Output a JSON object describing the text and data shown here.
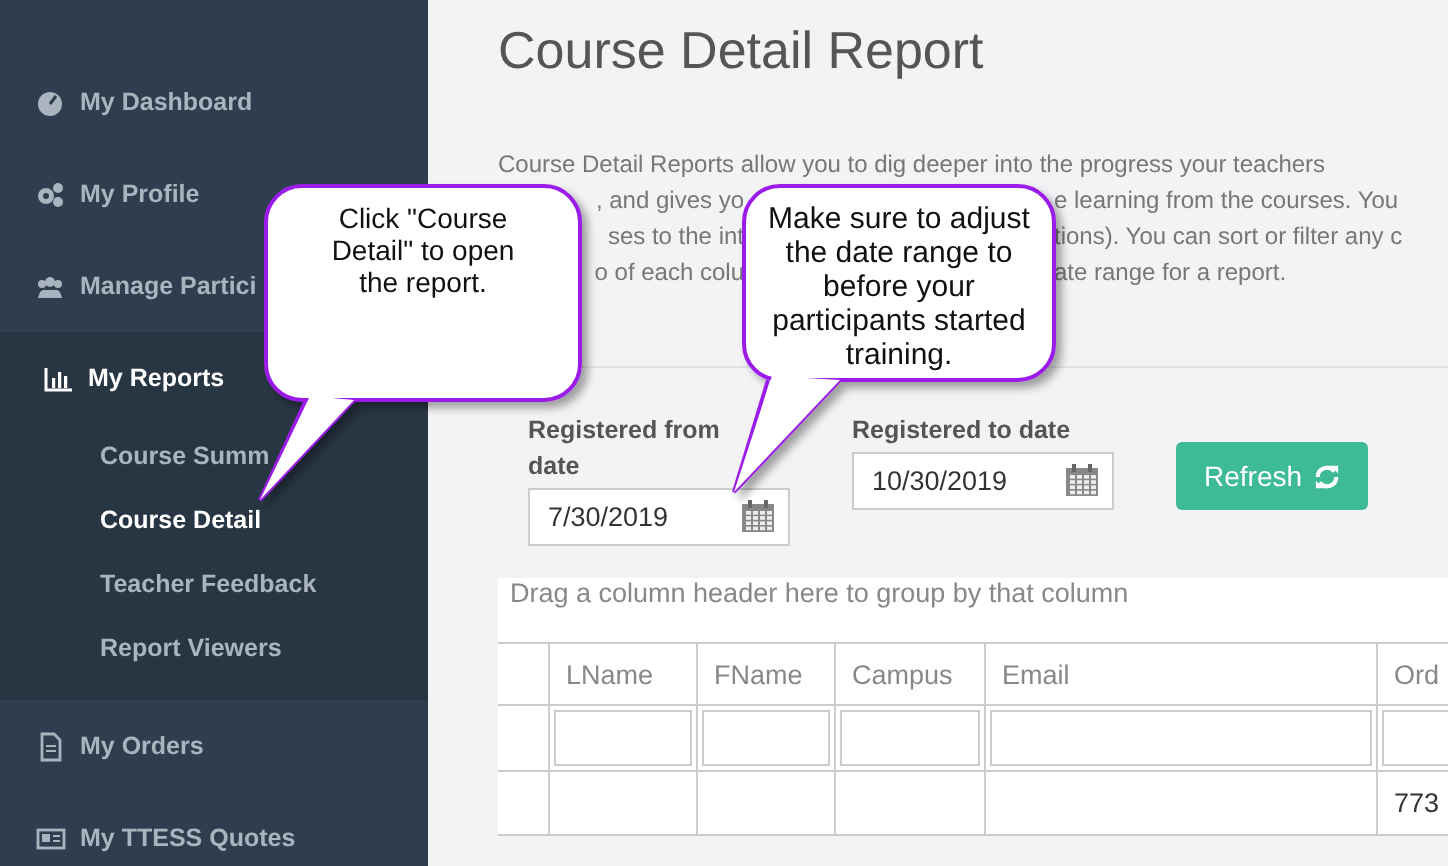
{
  "sidebar": {
    "items": [
      {
        "label": "My Dashboard",
        "selected": false
      },
      {
        "label": "My Profile",
        "selected": false
      },
      {
        "label": "Manage Partici",
        "selected": false
      },
      {
        "label": "My Reports",
        "selected": true,
        "children": [
          {
            "label": "Course Summ",
            "selected": false
          },
          {
            "label": "Course Detail",
            "selected": true
          },
          {
            "label": "Teacher Feedback",
            "selected": false
          },
          {
            "label": "Report Viewers",
            "selected": false
          }
        ]
      },
      {
        "label": "My Orders",
        "selected": false
      },
      {
        "label": "My TTESS Quotes",
        "selected": false
      }
    ]
  },
  "page_title": "Course Detail Report",
  "intro_lines": [
    {
      "segments": [
        "Course Detail Reports allow you to dig deeper into the progress your teachers"
      ]
    },
    {
      "segments": [
        ", and gives yo",
        "e learning from the courses. You"
      ]
    },
    {
      "segments": [
        "ses to the int",
        "tions). You can sort or filter any c"
      ]
    },
    {
      "segments": [
        "o of each colu",
        "ate range for a report."
      ]
    }
  ],
  "filters": [
    {
      "label": "Registered from date",
      "value": "7/30/2019"
    },
    {
      "label": "Registered to date",
      "value": "10/30/2019"
    }
  ],
  "refresh_button": "Refresh",
  "grid": {
    "group_hint": "Drag a column header here to group by that column",
    "columns": [
      "",
      "LName",
      "FName",
      "Campus",
      "Email",
      "Ord"
    ],
    "rows": [
      [
        "",
        "",
        "",
        "",
        "",
        "773"
      ]
    ]
  },
  "callouts": [
    {
      "text": "Click \"Course Detail\" to open the report."
    },
    {
      "text": "Make sure to adjust the date range to before your participants started training."
    }
  ]
}
